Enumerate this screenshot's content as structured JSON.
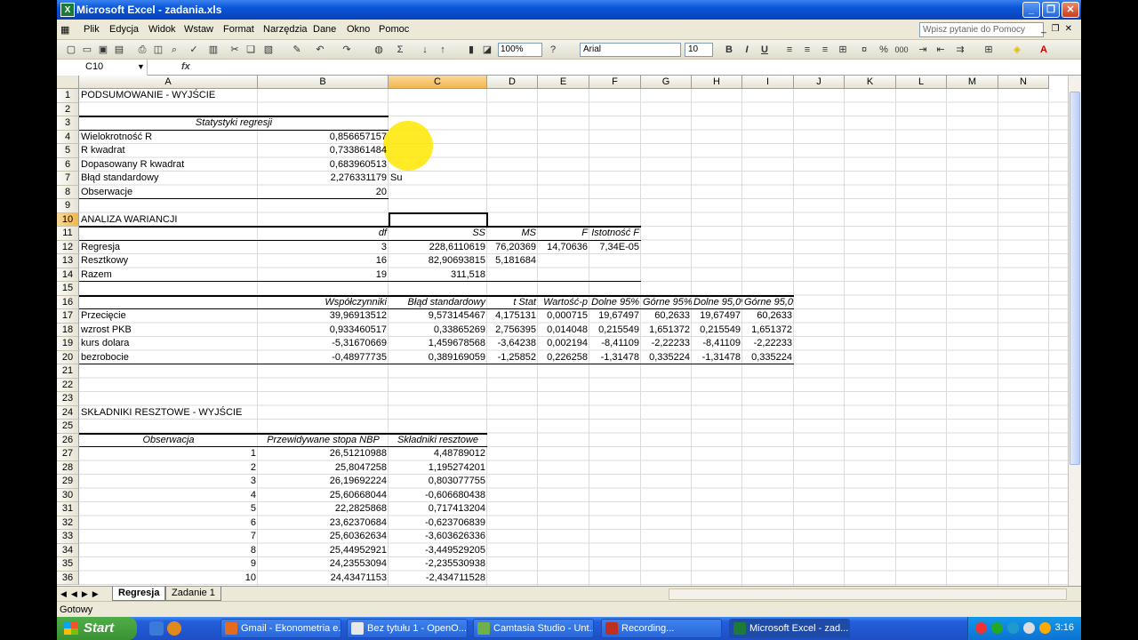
{
  "window": {
    "title": "Microsoft Excel - zadania.xls"
  },
  "menu": [
    "Plik",
    "Edycja",
    "Widok",
    "Wstaw",
    "Format",
    "Narzędzia",
    "Dane",
    "Okno",
    "Pomoc"
  ],
  "help_placeholder": "Wpisz pytanie do Pomocy",
  "toolbar": {
    "zoom": "100%",
    "font": "Arial",
    "size": "10",
    "bold": "B",
    "italic": "I",
    "underline": "U",
    "percent": "%",
    "thousands": "000"
  },
  "namebox": "C10",
  "fx": "fx",
  "columns": [
    "A",
    "B",
    "C",
    "D",
    "E",
    "F",
    "G",
    "H",
    "I",
    "J",
    "K",
    "L",
    "M",
    "N"
  ],
  "rows": [
    "1",
    "2",
    "3",
    "4",
    "5",
    "6",
    "7",
    "8",
    "9",
    "10",
    "11",
    "12",
    "13",
    "14",
    "15",
    "16",
    "17",
    "18",
    "19",
    "20",
    "21",
    "22",
    "23",
    "24",
    "25",
    "26",
    "27",
    "28",
    "29",
    "30",
    "31",
    "32",
    "33",
    "34",
    "35",
    "36"
  ],
  "cells": {
    "a1": "PODSUMOWANIE - WYJŚCIE",
    "reg_stats": "Statystyki regresji",
    "a4": "Wielokrotność R",
    "b4": "0,856657157",
    "a5": "R kwadrat",
    "b5": "0,733861484",
    "a6": "Dopasowany R kwadrat",
    "b6": "0,683960513",
    "a7": "Błąd standardowy",
    "b7": "2,276331179",
    "c7": "Su",
    "a8": "Obserwacje",
    "b8": "20",
    "a10": "ANALIZA WARIANCJI",
    "h11": [
      "df",
      "SS",
      "MS",
      "F",
      "Istotność F"
    ],
    "a12": "Regresja",
    "b12": "3",
    "c12": "228,6110619",
    "d12": "76,20369",
    "e12": "14,70636",
    "f12": "7,34E-05",
    "a13": "Resztkowy",
    "b13": "16",
    "c13": "82,90693815",
    "d13": "5,181684",
    "a14": "Razem",
    "b14": "19",
    "c14": "311,518",
    "h16": [
      "Współczynniki",
      "Błąd standardowy",
      "t Stat",
      "Wartość-p",
      "Dolne 95%",
      "Górne 95%",
      "Dolne 95,0%",
      "Górne 95,0%"
    ],
    "r17": [
      "Przecięcie",
      "39,96913512",
      "9,573145467",
      "4,175131",
      "0,000715",
      "19,67497",
      "60,2633",
      "19,67497",
      "60,2633"
    ],
    "r18": [
      "wzrost PKB",
      "0,933460517",
      "0,33865269",
      "2,756395",
      "0,014048",
      "0,215549",
      "1,651372",
      "0,215549",
      "1,651372"
    ],
    "r19": [
      "kurs dolara",
      "-5,31670669",
      "1,459678568",
      "-3,64238",
      "0,002194",
      "-8,41109",
      "-2,22233",
      "-8,41109",
      "-2,22233"
    ],
    "r20": [
      "bezrobocie",
      "-0,48977735",
      "0,389169059",
      "-1,25852",
      "0,226258",
      "-1,31478",
      "0,335224",
      "-1,31478",
      "0,335224"
    ],
    "a24": "SKŁADNIKI RESZTOWE - WYJŚCIE",
    "h26": [
      "Obserwacja",
      "Przewidywane stopa NBP",
      "Składniki resztowe"
    ],
    "resid": [
      [
        "1",
        "26,51210988",
        "4,48789012"
      ],
      [
        "2",
        "25,8047258",
        "1,195274201"
      ],
      [
        "3",
        "26,19692224",
        "0,803077755"
      ],
      [
        "4",
        "25,60668044",
        "-0,606680438"
      ],
      [
        "5",
        "22,2825868",
        "0,717413204"
      ],
      [
        "6",
        "23,62370684",
        "-0,623706839"
      ],
      [
        "7",
        "25,60362634",
        "-3,603626336"
      ],
      [
        "8",
        "25,44952921",
        "-3,449529205"
      ],
      [
        "9",
        "24,23553094",
        "-2,235530938"
      ],
      [
        "10",
        "24,43471153",
        "-2,434711528"
      ]
    ]
  },
  "sheets": [
    "Regresja",
    "Zadanie 1"
  ],
  "status": "Gotowy",
  "taskbar": {
    "start": "Start",
    "tasks": [
      "Gmail - Ekonometria e...",
      "Bez tytułu 1 - OpenO...",
      "Camtasia Studio - Unt...",
      "Recording...",
      "Microsoft Excel - zad..."
    ],
    "clock": "3:16"
  },
  "colors": {
    "accent": "#0a55d8",
    "selected_header": "#f2b64c",
    "highlight": "#ffe600"
  }
}
